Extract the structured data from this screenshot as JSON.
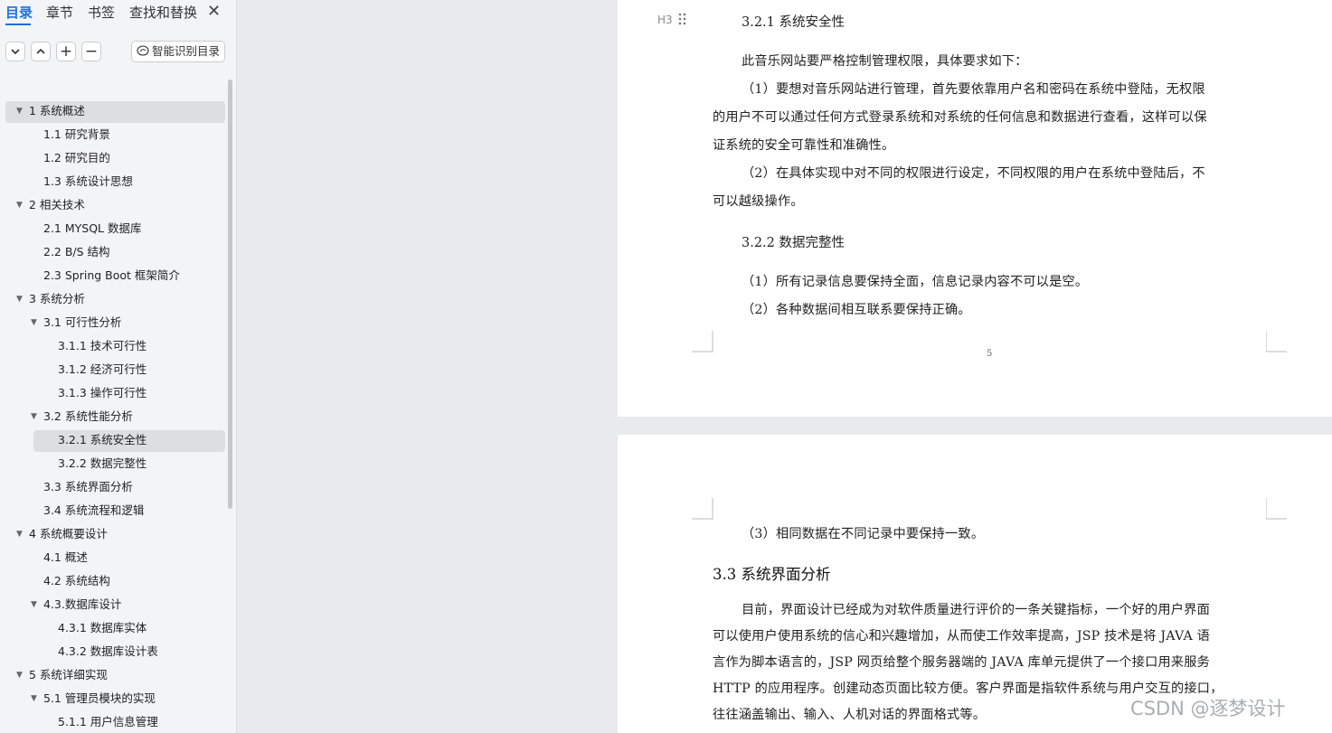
{
  "sidebar": {
    "tabs": [
      {
        "label": "目录",
        "active": true
      },
      {
        "label": "章节"
      },
      {
        "label": "书签"
      },
      {
        "label": "查找和替换"
      }
    ],
    "close_symbol": "✕",
    "toolbar": {
      "collapse_symbol": "⌄",
      "expand_symbol": "⌃",
      "add_symbol": "+",
      "remove_symbol": "−",
      "smart_label": "智能识别目录"
    },
    "toc": [
      {
        "label": "1 系统概述",
        "level": 0,
        "expanded": true,
        "selected_parent": true
      },
      {
        "label": "1.1  研究背景",
        "level": 1
      },
      {
        "label": "1.2 研究目的",
        "level": 1
      },
      {
        "label": "1.3 系统设计思想",
        "level": 1
      },
      {
        "label": "2 相关技术",
        "level": 0,
        "expanded": true
      },
      {
        "label": "2.1 MYSQL 数据库",
        "level": 1
      },
      {
        "label": "2.2 B/S 结构",
        "level": 1
      },
      {
        "label": "2.3 Spring Boot 框架简介",
        "level": 1
      },
      {
        "label": "3 系统分析",
        "level": 0,
        "expanded": true
      },
      {
        "label": "3.1 可行性分析",
        "level": 1,
        "expanded": true
      },
      {
        "label": "3.1.1 技术可行性",
        "level": 2
      },
      {
        "label": "3.1.2 经济可行性",
        "level": 2
      },
      {
        "label": "3.1.3 操作可行性",
        "level": 2
      },
      {
        "label": "3.2 系统性能分析",
        "level": 1,
        "expanded": true
      },
      {
        "label": "3.2.1  系统安全性",
        "level": 2,
        "current": true
      },
      {
        "label": "3.2.2  数据完整性",
        "level": 2
      },
      {
        "label": "3.3 系统界面分析",
        "level": 1
      },
      {
        "label": "3.4 系统流程和逻辑",
        "level": 1
      },
      {
        "label": "4 系统概要设计",
        "level": 0,
        "expanded": true
      },
      {
        "label": "4.1 概述",
        "level": 1
      },
      {
        "label": "4.2 系统结构",
        "level": 1
      },
      {
        "label": "4.3.数据库设计",
        "level": 1,
        "expanded": true
      },
      {
        "label": "4.3.1 数据库实体",
        "level": 2
      },
      {
        "label": "4.3.2 数据库设计表",
        "level": 2
      },
      {
        "label": "5 系统详细实现",
        "level": 0,
        "expanded": true
      },
      {
        "label": "5.1  管理员模块的实现",
        "level": 1,
        "expanded": true
      },
      {
        "label": "5.1.1  用户信息管理",
        "level": 2
      }
    ]
  },
  "document": {
    "page1": {
      "heading_marker": "H3",
      "heading_321": "3.2.1  系统安全性",
      "intro": "此音乐网站要严格控制管理权限，具体要求如下：",
      "p1_l1": "（1）要想对音乐网站进行管理，首先要依靠用户名和密码在系统中登陆，无权限",
      "p1_l2": "的用户不可以通过任何方式登录系统和对系统的任何信息和数据进行查看，这样可以保",
      "p1_l3": "证系统的安全可靠性和准确性。",
      "p2_l1": "（2）在具体实现中对不同的权限进行设定，不同权限的用户在系统中登陆后，不",
      "p2_l2": "可以越级操作。",
      "heading_322": "3.2.2  数据完整性",
      "d1": "（1）所有记录信息要保持全面，信息记录内容不可以是空。",
      "d2": "（2）各种数据间相互联系要保持正确。",
      "page_number": "5"
    },
    "page2": {
      "d3": "（3）相同数据在不同记录中要保持一致。",
      "heading_33": "3.3 系统界面分析",
      "u1": "目前，界面设计已经成为对软件质量进行评价的一条关键指标，一个好的用户界面",
      "u2": "可以使用户使用系统的信心和兴趣增加，从而使工作效率提高，JSP 技术是将 JAVA 语",
      "u3": "言作为脚本语言的，JSP 网页给整个服务器端的 JAVA 库单元提供了一个接口用来服务",
      "u4": "HTTP 的应用程序。创建动态页面比较方便。客户界面是指软件系统与用户交互的接口，",
      "u5": "往往涵盖输出、输入、人机对话的界面格式等。"
    }
  },
  "watermark": "CSDN @逐梦设计",
  "colors": {
    "accent": "#1f6fde",
    "sidebar_bg": "#f3f4f6",
    "highlight": "#dcdee2"
  }
}
